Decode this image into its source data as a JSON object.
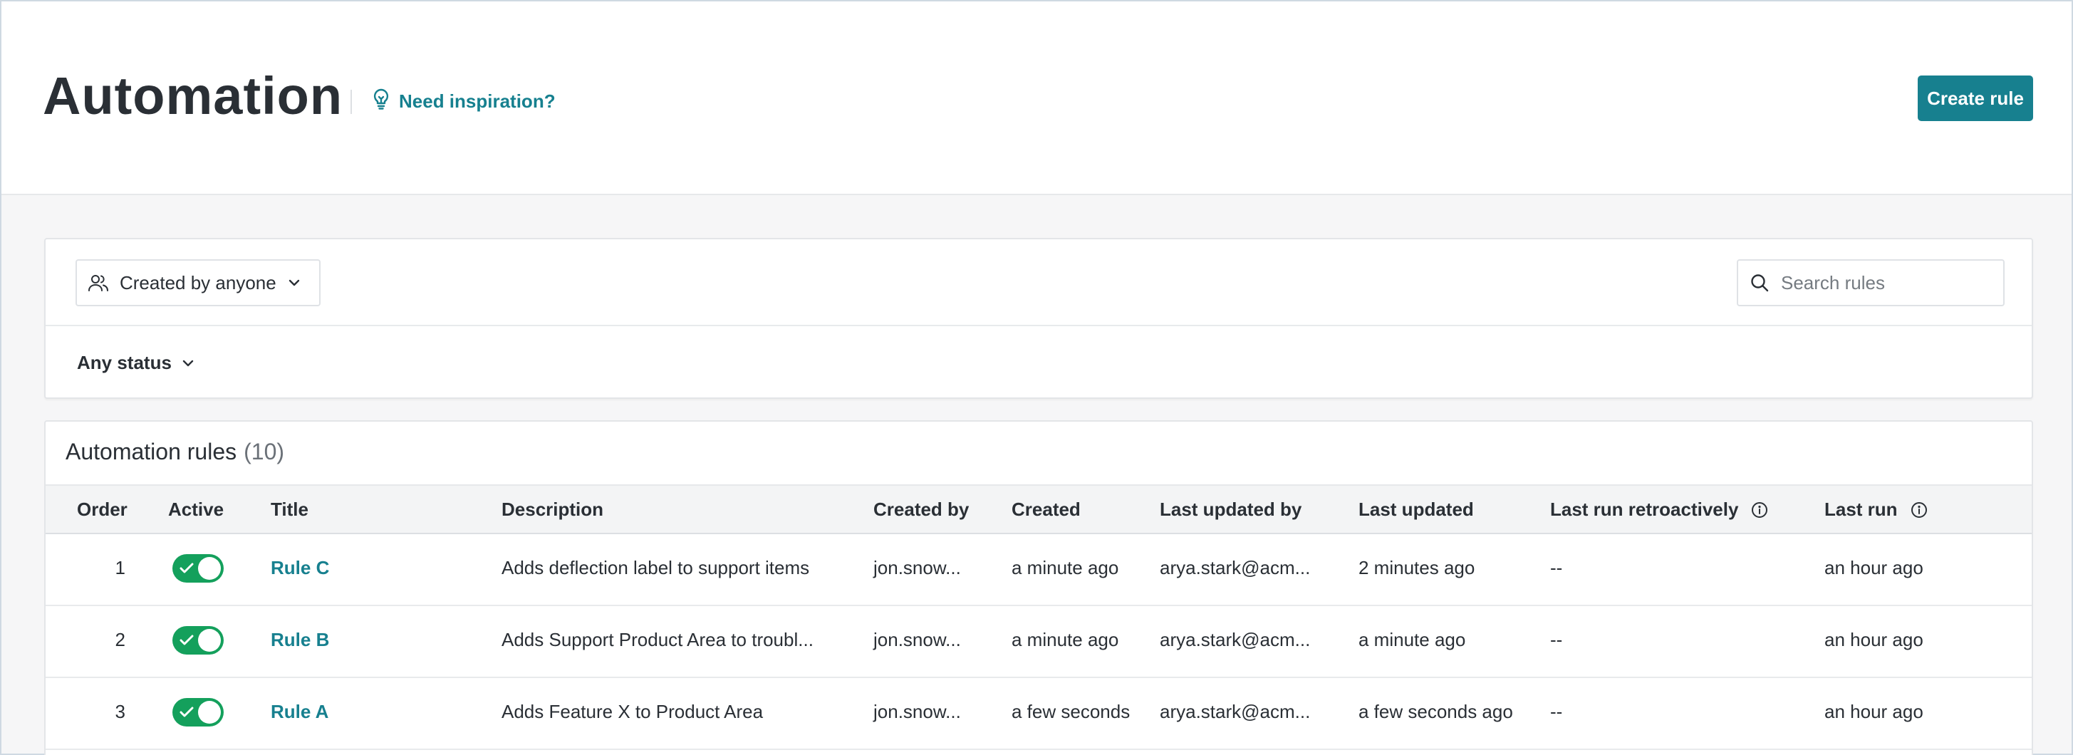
{
  "header": {
    "title": "Automation",
    "inspiration_label": "Need inspiration?",
    "create_label": "Create rule"
  },
  "filters": {
    "creator_label": "Created by anyone",
    "search_placeholder": "Search rules",
    "status_label": "Any status"
  },
  "rules": {
    "heading": "Automation rules",
    "count": "(10)",
    "columns": {
      "order": "Order",
      "active": "Active",
      "title": "Title",
      "description": "Description",
      "created_by": "Created by",
      "created": "Created",
      "last_updated_by": "Last updated by",
      "last_updated": "Last updated",
      "last_run_retro": "Last run retroactively",
      "last_run": "Last run"
    },
    "rows": [
      {
        "order": "1",
        "active": true,
        "title": "Rule C",
        "description": "Adds deflection label to support items",
        "created_by": "jon.snow...",
        "created": "a minute ago",
        "last_updated_by": "arya.stark@acm...",
        "last_updated": "2 minutes ago",
        "last_run_retro": "--",
        "last_run": "an hour ago"
      },
      {
        "order": "2",
        "active": true,
        "title": "Rule B",
        "description": "Adds Support Product Area to troubl...",
        "created_by": "jon.snow...",
        "created": "a minute ago",
        "last_updated_by": "arya.stark@acm...",
        "last_updated": "a minute ago",
        "last_run_retro": "--",
        "last_run": "an hour ago"
      },
      {
        "order": "3",
        "active": true,
        "title": "Rule A",
        "description": "Adds Feature X to Product Area",
        "created_by": "jon.snow...",
        "created": "a few seconds",
        "last_updated_by": "arya.stark@acm...",
        "last_updated": "a few seconds ago",
        "last_run_retro": "--",
        "last_run": "an hour ago"
      }
    ]
  },
  "colors": {
    "accent": "#17808f",
    "toggle_on": "#14a05c",
    "page_bg": "#f6f6f7"
  },
  "icons": {
    "inspiration": "lightbulb-icon",
    "creator": "people-icon",
    "dropdown": "chevron-down-icon",
    "search": "search-icon",
    "info": "info-icon",
    "toggle_check": "check-icon"
  }
}
